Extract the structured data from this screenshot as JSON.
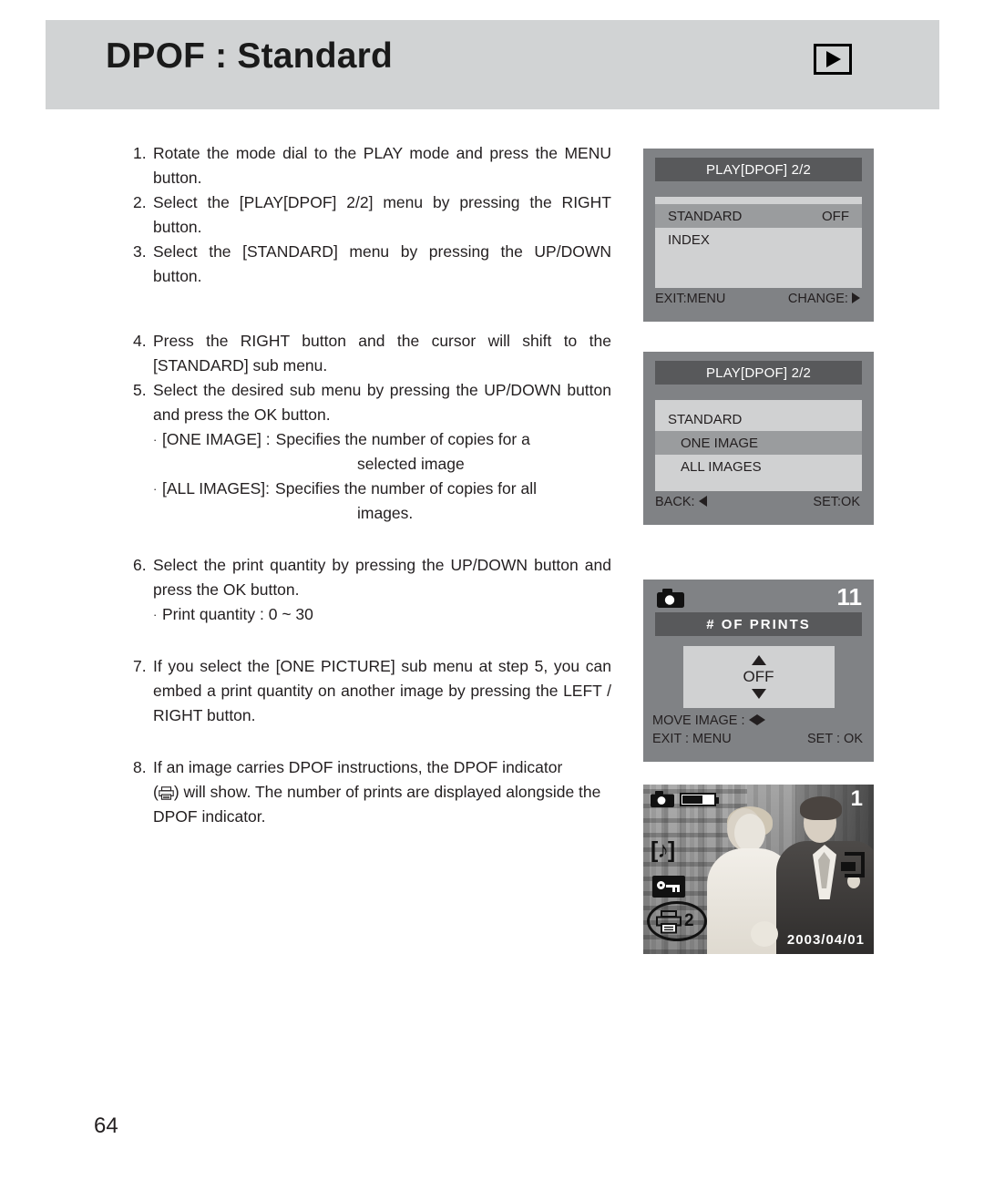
{
  "header": {
    "title": "DPOF : Standard",
    "play_icon": "play-icon"
  },
  "instructions": [
    {
      "num": "1.",
      "text": "Rotate the mode dial to the PLAY mode and press the MENU button."
    },
    {
      "num": "2.",
      "text": "Select the [PLAY[DPOF] 2/2] menu by pressing the RIGHT button."
    },
    {
      "num": "3.",
      "text": "Select the [STANDARD] menu by pressing the UP/DOWN button."
    },
    {
      "num": "4.",
      "text": "Press the RIGHT button and the cursor will shift to the [STANDARD] sub menu."
    },
    {
      "num": "5.",
      "text": "Select the desired sub menu by pressing the UP/DOWN button and press the OK button."
    },
    {
      "num": "6.",
      "text": "Select the print quantity by pressing the UP/DOWN button and press the OK button."
    },
    {
      "num": "7.",
      "text": "If you select the [ONE PICTURE] sub menu at step 5, you can embed a print quantity on another image by pressing the LEFT / RIGHT button."
    },
    {
      "num": "8a",
      "text": "If an image carries DPOF instructions, the DPOF indicator"
    },
    {
      "num": "8b",
      "text": ") will show. The number of prints are displayed alongside the DPOF indicator."
    }
  ],
  "sub_items": {
    "one_image_label": "[ONE IMAGE] :",
    "one_image_text": "Specifies the number of copies for a",
    "one_image_text2": "selected image",
    "all_images_label": "[ALL IMAGES]:",
    "all_images_text": "Specifies the number of copies for all",
    "all_images_text2": "images.",
    "print_quantity": "Print quantity : 0 ~ 30"
  },
  "lcd_panels": [
    {
      "title": "PLAY[DPOF] 2/2",
      "rows": [
        {
          "label": "STANDARD",
          "value": "OFF",
          "highlighted": true
        },
        {
          "label": "INDEX",
          "value": "",
          "highlighted": false
        }
      ],
      "footer_left": "EXIT:MENU",
      "footer_right": "CHANGE:"
    },
    {
      "title": "PLAY[DPOF] 2/2",
      "rows": [
        {
          "label": "STANDARD",
          "value": "",
          "highlighted": false
        },
        {
          "label": "ONE IMAGE",
          "value": "",
          "highlighted": true
        },
        {
          "label": "ALL IMAGES",
          "value": "",
          "highlighted": false
        }
      ],
      "footer_left": "BACK:",
      "footer_right": "SET:OK"
    },
    {
      "title": "#   OF   PRINTS",
      "image_count": "11",
      "value": "OFF",
      "footer_line1": "MOVE IMAGE :",
      "footer_line2": "EXIT : MENU",
      "footer_right": "SET : OK"
    },
    {
      "image_count": "1",
      "dpof_count": "2",
      "date": "2003/04/01",
      "icons": [
        "camera-icon",
        "battery-icon",
        "sound-icon",
        "key-lock-icon",
        "dpof-printer-icon",
        "card-icon"
      ]
    }
  ],
  "page_number": "64",
  "colors": {
    "banner": "#d1d3d4",
    "lcd_background": "#808285",
    "lcd_titlebar": "#58595b",
    "lcd_content": "#d0d1d2",
    "lcd_highlight": "#9a9c9e",
    "text": "#231f20"
  }
}
